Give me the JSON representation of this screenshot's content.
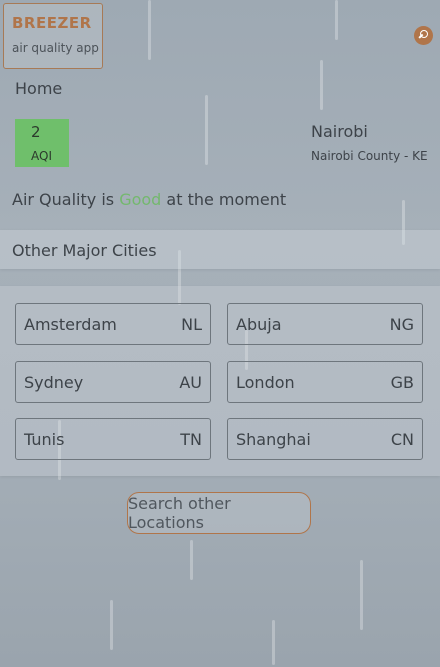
{
  "brand": {
    "title": "BREEZER",
    "subtitle": "air quality app"
  },
  "nav": {
    "home": "Home"
  },
  "current": {
    "aqi_value": "2",
    "aqi_label": "AQI",
    "city": "Nairobi",
    "region": "Nairobi County - KE",
    "status_prefix": "Air Quality is",
    "status_word": "Good",
    "status_suffix": "at the moment"
  },
  "colors": {
    "accent": "#b0754a",
    "good": "#74b86e",
    "aqi_bg": "#6fbf6b"
  },
  "other_cities": {
    "header": "Other Major Cities",
    "items": [
      {
        "name": "Amsterdam",
        "code": "NL"
      },
      {
        "name": "Abuja",
        "code": "NG"
      },
      {
        "name": "Sydney",
        "code": "AU"
      },
      {
        "name": "London",
        "code": "GB"
      },
      {
        "name": "Tunis",
        "code": "TN"
      },
      {
        "name": "Shanghai",
        "code": "CN"
      }
    ]
  },
  "search": {
    "label": "Search other Locations"
  }
}
